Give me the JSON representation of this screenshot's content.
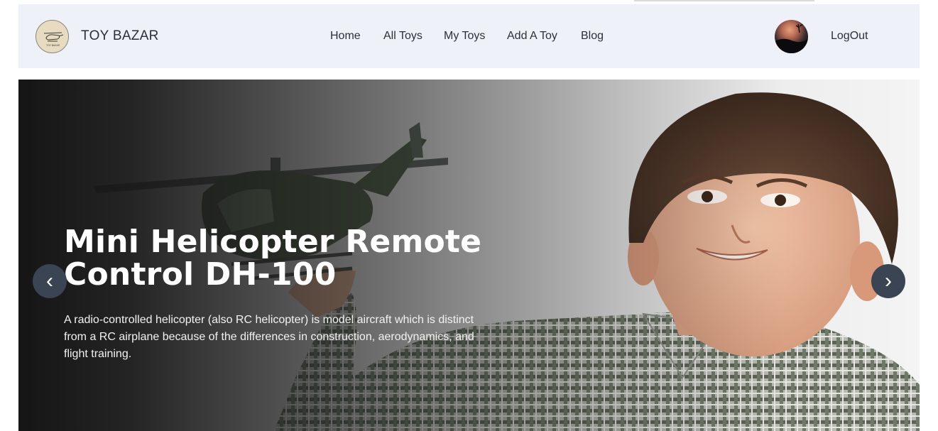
{
  "navbar": {
    "brand": "TOY BAZAR",
    "logo_text": "TOY BAZAR",
    "logo_icon": "helicopter-icon",
    "menu": [
      {
        "label": "Home"
      },
      {
        "label": "All Toys"
      },
      {
        "label": "My Toys"
      },
      {
        "label": "Add A Toy"
      },
      {
        "label": "Blog"
      }
    ],
    "logout_label": "LogOut"
  },
  "hero": {
    "title": "Mini Helicopter Remote Control DH-100",
    "description": "A radio-controlled helicopter (also RC helicopter) is model aircraft which is distinct from a RC airplane because of the differences in construction, aerodynamics, and flight training.",
    "prev_label": "‹",
    "next_label": "›"
  },
  "colors": {
    "navbar_bg": "#eef2f8",
    "slide_button": "#3b4452",
    "text_dark": "#2b2f38"
  }
}
